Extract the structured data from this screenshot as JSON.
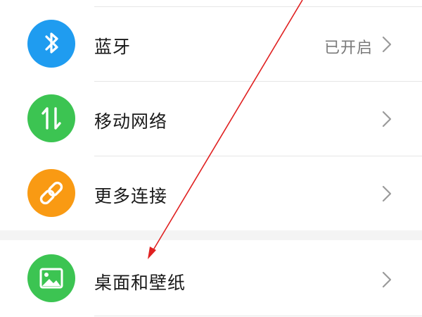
{
  "settings": {
    "items": [
      {
        "label": "蓝牙",
        "value": "已开启",
        "icon": "bluetooth-icon",
        "color": "#1f9cf0"
      },
      {
        "label": "移动网络",
        "value": "",
        "icon": "mobile-data-icon",
        "color": "#3cc452"
      },
      {
        "label": "更多连接",
        "value": "",
        "icon": "link-icon",
        "color": "#f99a13"
      },
      {
        "label": "桌面和壁纸",
        "value": "",
        "icon": "wallpaper-icon",
        "color": "#3cc452"
      }
    ]
  },
  "colors": {
    "divider": "#e6e6e6",
    "section_gap": "#f4f4f4",
    "annotation_arrow": "#e02020",
    "chevron": "#9a9a9a"
  }
}
